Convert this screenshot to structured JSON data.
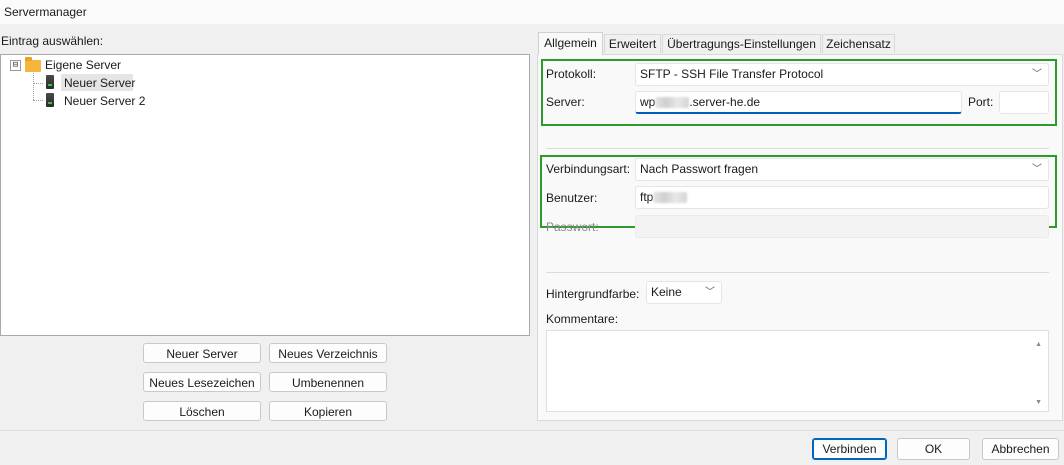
{
  "window": {
    "title": "Servermanager"
  },
  "left": {
    "entry_label": "Eintrag auswählen:",
    "tree": {
      "root": {
        "label": "Eigene Server",
        "expander": "⊟"
      },
      "items": [
        {
          "label": "Neuer Server",
          "selected": true
        },
        {
          "label": "Neuer Server 2",
          "selected": false
        }
      ]
    },
    "buttons": {
      "new_server": "Neuer Server",
      "new_folder": "Neues Verzeichnis",
      "new_bookmark": "Neues Lesezeichen",
      "rename": "Umbenennen",
      "delete": "Löschen",
      "copy": "Kopieren"
    }
  },
  "tabs": [
    "Allgemein",
    "Erweitert",
    "Übertragungs-Einstellungen",
    "Zeichensatz"
  ],
  "general": {
    "protocol_label": "Protokoll:",
    "protocol_value": "SFTP - SSH File Transfer Protocol",
    "server_label": "Server:",
    "server_prefix": "wp",
    "server_suffix": ".server-he.de",
    "port_label": "Port:",
    "port_value": "",
    "logon_type_label": "Verbindungsart:",
    "logon_type_value": "Nach Passwort fragen",
    "user_label": "Benutzer:",
    "user_prefix": "ftp",
    "password_label": "Passwort:",
    "bg_color_label": "Hintergrundfarbe:",
    "bg_color_value": "Keine",
    "comments_label": "Kommentare:"
  },
  "footer": {
    "connect": "Verbinden",
    "ok": "OK",
    "cancel": "Abbrechen"
  },
  "colors": {
    "highlight_box": "#2e9a2e",
    "focus": "#005fb8",
    "folder": "#f4b73b"
  }
}
